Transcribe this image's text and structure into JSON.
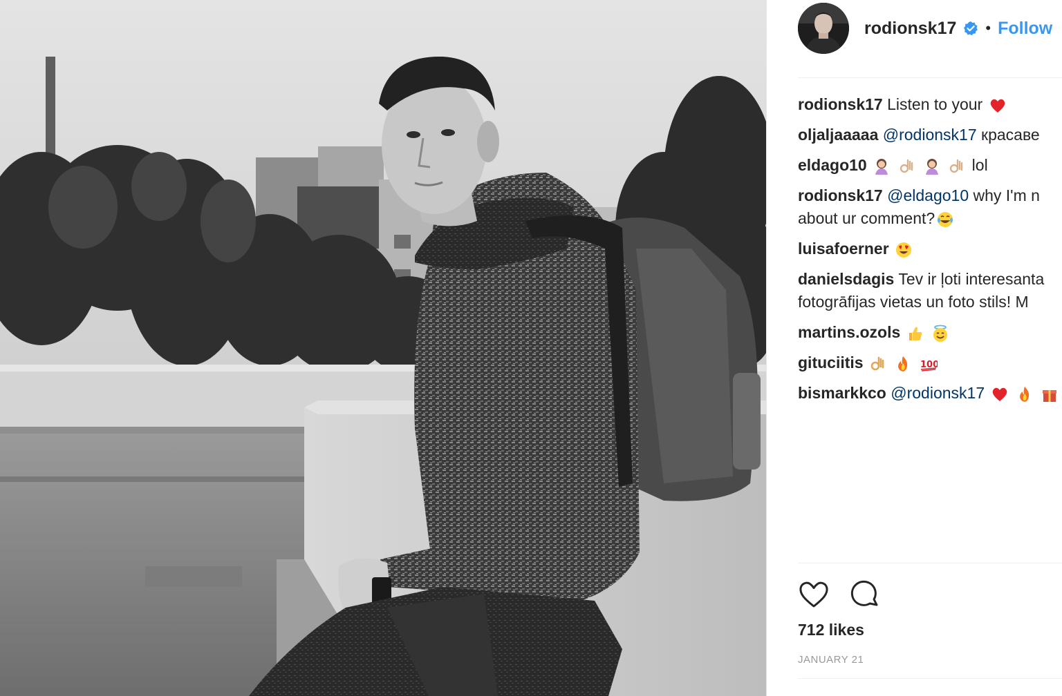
{
  "post": {
    "username": "rodionsk17",
    "separator": "•",
    "follow_label": "Follow",
    "likes": "712 likes",
    "date": "January 21",
    "photo_icon": "photo-image",
    "avatar_icon": "avatar-image",
    "verified_icon": "verified-badge-icon"
  },
  "comments": [
    {
      "author": "rodionsk17",
      "mention": "",
      "text": "Listen to your",
      "emojis": [
        "red-heart"
      ]
    },
    {
      "author": "oljaljaaaaa",
      "mention": "@rodionsk17",
      "text": "красаве",
      "emojis": []
    },
    {
      "author": "eldago10",
      "mention": "",
      "text": "lol",
      "emojis_before": [
        "woman-facepalming",
        "ok-hand",
        "woman-facepalming",
        "ok-hand"
      ]
    },
    {
      "author": "rodionsk17",
      "mention": "@eldago10",
      "text": "why I'm n",
      "text2": "about ur comment?",
      "emojis": [
        "tears-of-joy"
      ]
    },
    {
      "author": "luisafoerner",
      "mention": "",
      "text": "",
      "emojis": [
        "heart-eyes"
      ]
    },
    {
      "author": "danielsdagis",
      "mention": "",
      "text": "Tev ir ļoti interesanta",
      "text2": "fotogrāfijas vietas un foto stils! M",
      "emojis": []
    },
    {
      "author": "martins.ozols",
      "mention": "",
      "text": "",
      "emojis": [
        "thumbs-up",
        "smiling-halo"
      ]
    },
    {
      "author": "gituciitis",
      "mention": "",
      "text": "",
      "emojis": [
        "ok-hand",
        "fire",
        "hundred"
      ]
    },
    {
      "author": "bismarkkco",
      "mention": "@rodionsk17",
      "text": "",
      "emojis": [
        "red-heart",
        "fire",
        "gift"
      ]
    }
  ],
  "actions": {
    "like_icon": "heart-outline-icon",
    "comment_icon": "comment-bubble-icon"
  },
  "colors": {
    "link_blue": "#3897f0",
    "mention_blue": "#003569",
    "text": "#262626",
    "muted": "#999999"
  }
}
